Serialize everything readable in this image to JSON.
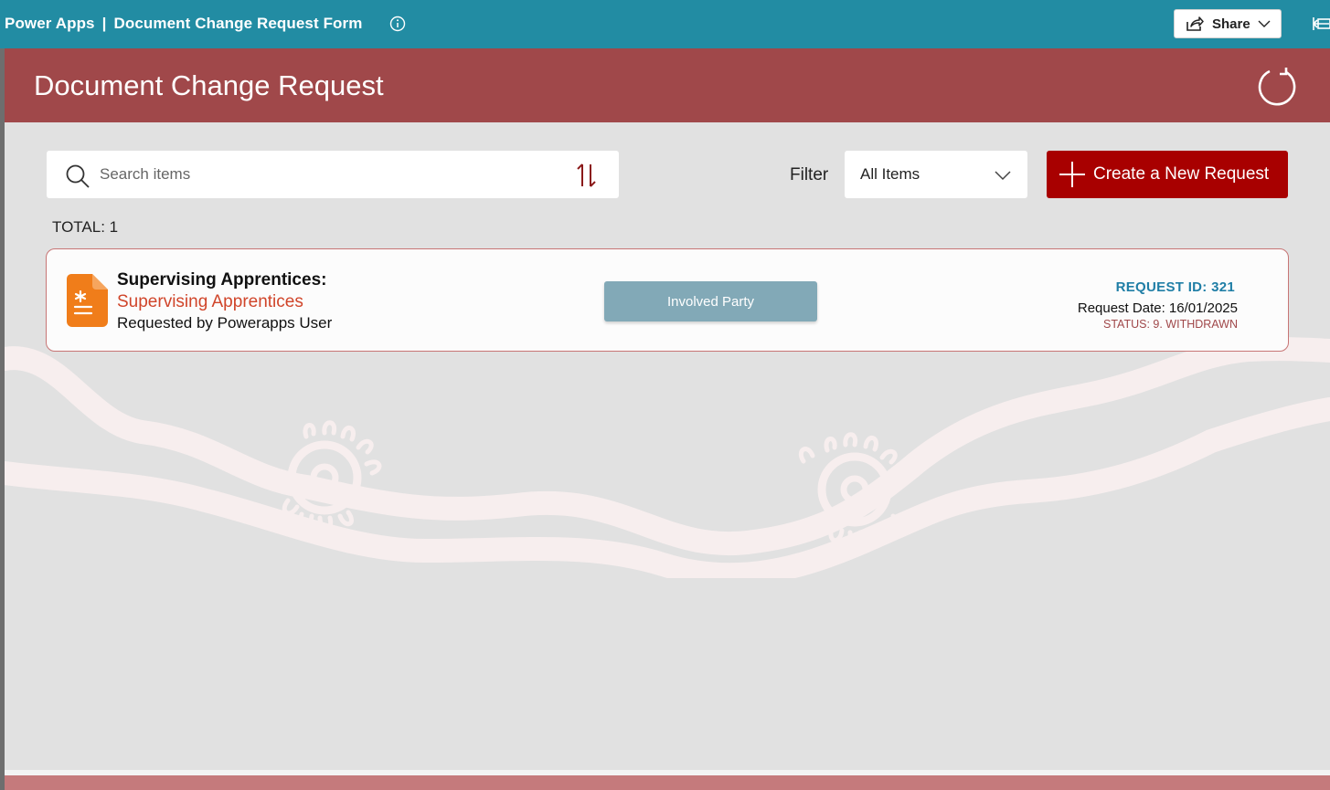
{
  "topbar": {
    "app_name": "Power Apps",
    "separator": "|",
    "form_title": "Document Change Request Form",
    "share_label": "Share"
  },
  "app": {
    "title": "Document Change Request",
    "search": {
      "placeholder": "Search items",
      "value": ""
    },
    "filter": {
      "label": "Filter",
      "selected": "All Items"
    },
    "create_button": "Create a New Request",
    "total": "TOTAL: 1",
    "records": [
      {
        "title": "Supervising Apprentices:",
        "subtitle": "Supervising Apprentices",
        "requested_by": "Requested by Powerapps User",
        "role_button": "Involved Party",
        "request_id": "REQUEST ID: 321",
        "request_date": "Request Date: 16/01/2025",
        "status": "STATUS: 9. WITHDRAWN",
        "icon": "document-icon"
      }
    ]
  },
  "colors": {
    "topbar": "#228ca3",
    "header": "#a0484a",
    "create_button": "#a80000",
    "role_button": "#82a9b7",
    "doc_icon": "#f07d1a"
  }
}
